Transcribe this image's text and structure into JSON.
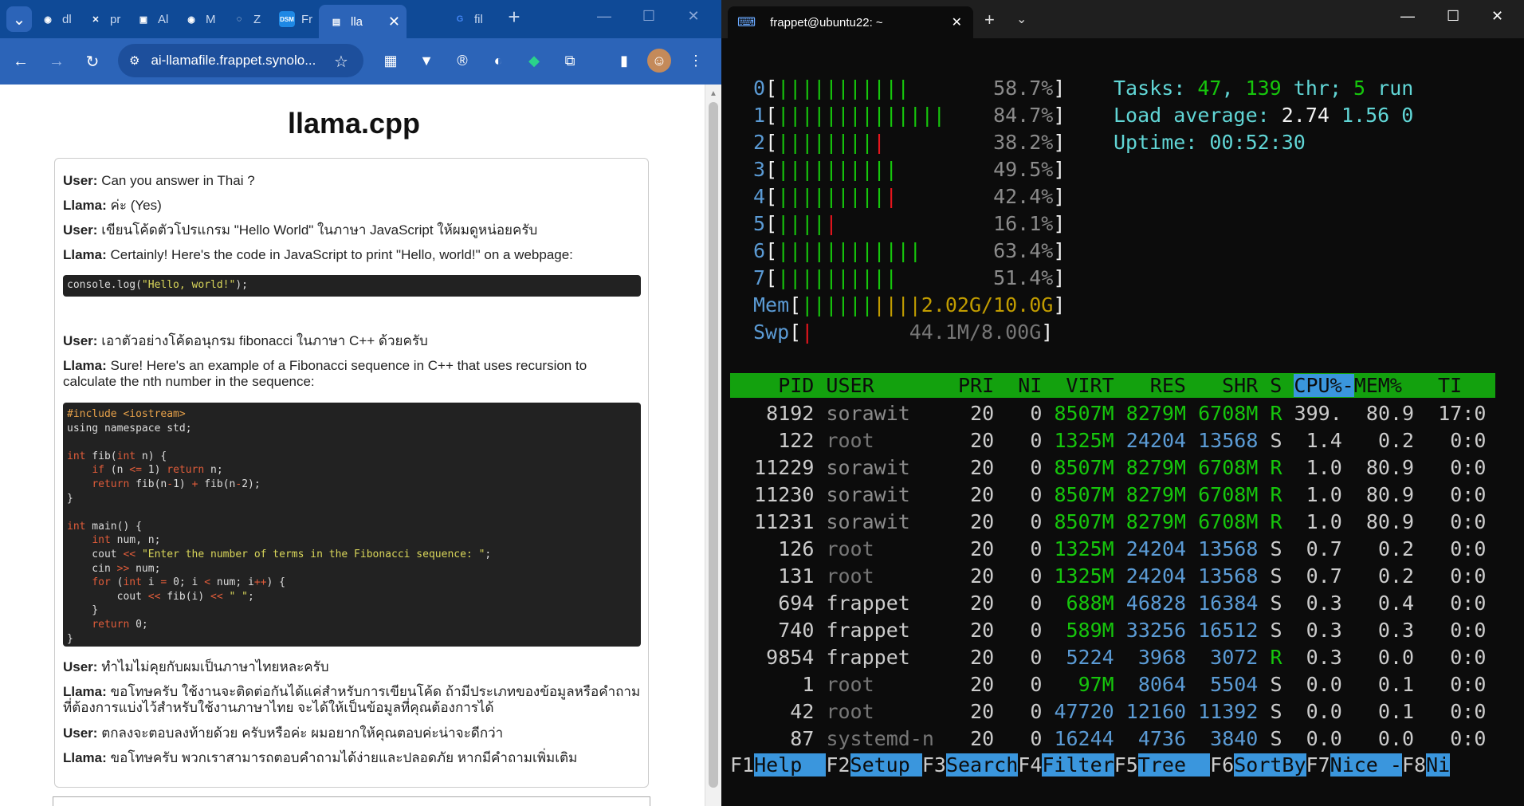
{
  "browser": {
    "tabs": [
      {
        "label": "dl",
        "icon": "github-icon"
      },
      {
        "label": "pr",
        "icon": "x-logo-icon"
      },
      {
        "label": "Al",
        "icon": "shield-icon"
      },
      {
        "label": "M",
        "icon": "github-icon"
      },
      {
        "label": "Z",
        "icon": "zerotier-icon"
      },
      {
        "label": "Fr",
        "icon": "dsm-icon"
      },
      {
        "label": "lla",
        "icon": "page-icon"
      },
      {
        "label": "fil",
        "icon": "google-icon"
      }
    ],
    "address": "ai-llamafile.frappet.synolo...",
    "page_title": "llama.cpp",
    "messages": [
      {
        "who": "User:",
        "text": " Can you answer in Thai ?"
      },
      {
        "who": "Llama:",
        "text": " ค่ะ (Yes)"
      },
      {
        "who": "User:",
        "text": " เขียนโค้ดตัวโปรแกรม \"Hello World\" ในภาษา JavaScript ให้ผมดูหน่อยครับ"
      },
      {
        "who": "Llama:",
        "text": " Certainly! Here's the code in JavaScript to print \"Hello, world!\" on a webpage:"
      },
      {
        "who": "User:",
        "text": " เอาตัวอย่างโค้ดอนุกรม fibonacci ในภาษา C++ ด้วยครับ"
      },
      {
        "who": "Llama:",
        "text": " Sure! Here's an example of a Fibonacci sequence in C++ that uses recursion to calculate the nth number in the sequence:"
      },
      {
        "who": "User:",
        "text": " ทำไมไม่คุยกับผมเป็นภาษาไทยหละครับ"
      },
      {
        "who": "Llama:",
        "text": " ขอโทษครับ ใช้งานจะติดต่อกันได้แค่สำหรับการเขียนโค้ด ถ้ามีประเภทของข้อมูลหรือคำถามที่ต้องการแบ่งไว้สำหรับใช้งานภาษาไทย จะได้ให้เป็นข้อมูลที่คุณต้องการได้"
      },
      {
        "who": "User:",
        "text": " ตกลงจะตอบลงท้ายด้วย ครับหรือค่ะ ผมอยากให้คุณตอบค่ะน่าจะดีกว่า"
      },
      {
        "who": "Llama:",
        "text": " ขอโทษครับ พวกเราสามารถตอบคำถามได้ง่ายและปลอดภัย หากมีคำถามเพิ่มเติม"
      }
    ],
    "code1": [
      "console.log(",
      "\"Hello, world!\"",
      ");"
    ],
    "code2": {
      "l1": "#include <iostream>",
      "l2": "using namespace std;",
      "fib_sig": " fib(",
      "fib_sig2": " n) {",
      "if_line": [
        "    ",
        "if",
        " (n ",
        "<=",
        " 1) ",
        "return",
        " n;"
      ],
      "ret_line": [
        "    ",
        "return",
        " fib(n",
        "-",
        "1) ",
        "+",
        " fib(n",
        "-",
        "2);"
      ],
      "main_sig": " main() {",
      "decl": " num, n;",
      "cout1": [
        "    cout ",
        "<<",
        " ",
        "\"Enter the number of terms in the Fibonacci sequence: \"",
        ";"
      ],
      "cin": [
        "    cin ",
        ">>",
        " num;"
      ],
      "for_line": [
        "    ",
        "for",
        " (",
        "int",
        " i ",
        "=",
        " 0; i ",
        "<",
        " num; i",
        "++",
        ") {"
      ],
      "cout2": [
        "        cout ",
        "<<",
        " fib(i) ",
        "<<",
        " ",
        "\" \"",
        ";"
      ],
      "close_in": "    }",
      "ret0": [
        "    ",
        "return",
        " 0;"
      ],
      "close": "}",
      "kw_int": "int",
      "open_brace": "{"
    }
  },
  "terminal": {
    "tab_title": "frappet@ubuntu22: ~",
    "cpus": [
      {
        "id": "0",
        "green": "|||||||||||",
        "red": "",
        "pct": "58.7%"
      },
      {
        "id": "1",
        "green": "||||||||||||||",
        "red": "",
        "pct": "84.7%"
      },
      {
        "id": "2",
        "green": "||||||||",
        "red": "|",
        "pct": "38.2%"
      },
      {
        "id": "3",
        "green": "||||||||||",
        "red": "",
        "pct": "49.5%"
      },
      {
        "id": "4",
        "green": "|||||||||",
        "red": "|",
        "pct": "42.4%"
      },
      {
        "id": "5",
        "green": "||||",
        "red": "|",
        "pct": "16.1%"
      },
      {
        "id": "6",
        "green": "||||||||||||",
        "red": "",
        "pct": "63.4%"
      },
      {
        "id": "7",
        "green": "||||||||||",
        "red": "",
        "pct": "51.4%"
      }
    ],
    "mem": {
      "label": "Mem",
      "green": "||||||",
      "yellow": "||||",
      "value": "2.02G/10.0G"
    },
    "swp": {
      "label": "Swp",
      "red": "|",
      "value": "44.1M/8.00G"
    },
    "tasks": {
      "label": "Tasks: ",
      "a": "47",
      "b": ", ",
      "c": "139",
      "d": " thr; ",
      "e": "5",
      "f": " run"
    },
    "load": {
      "label": "Load average: ",
      "a": "2.74",
      "b": "1.56",
      "c": "0"
    },
    "uptime": {
      "label": "Uptime: ",
      "value": "00:52:30"
    },
    "header": [
      "    PID USER       PRI  NI  VIRT   RES   SHR S ",
      "CPU%-",
      "MEM%   TI"
    ],
    "processes": [
      {
        "pid": "8192",
        "user": "sorawit",
        "pri": "20",
        "ni": "0",
        "virt": "8507M",
        "res": "8279M",
        "shr": "6708M",
        "s": "R",
        "cpu": "399.",
        "mem": "80.9",
        "time": "17:0"
      },
      {
        "pid": "122",
        "user": "root",
        "pri": "20",
        "ni": "0",
        "virt": "1325M",
        "res": "24204",
        "shr": "13568",
        "s": "S",
        "cpu": "1.4",
        "mem": "0.2",
        "time": "0:0"
      },
      {
        "pid": "11229",
        "user": "sorawit",
        "pri": "20",
        "ni": "0",
        "virt": "8507M",
        "res": "8279M",
        "shr": "6708M",
        "s": "R",
        "cpu": "1.0",
        "mem": "80.9",
        "time": "0:0"
      },
      {
        "pid": "11230",
        "user": "sorawit",
        "pri": "20",
        "ni": "0",
        "virt": "8507M",
        "res": "8279M",
        "shr": "6708M",
        "s": "R",
        "cpu": "1.0",
        "mem": "80.9",
        "time": "0:0"
      },
      {
        "pid": "11231",
        "user": "sorawit",
        "pri": "20",
        "ni": "0",
        "virt": "8507M",
        "res": "8279M",
        "shr": "6708M",
        "s": "R",
        "cpu": "1.0",
        "mem": "80.9",
        "time": "0:0"
      },
      {
        "pid": "126",
        "user": "root",
        "pri": "20",
        "ni": "0",
        "virt": "1325M",
        "res": "24204",
        "shr": "13568",
        "s": "S",
        "cpu": "0.7",
        "mem": "0.2",
        "time": "0:0"
      },
      {
        "pid": "131",
        "user": "root",
        "pri": "20",
        "ni": "0",
        "virt": "1325M",
        "res": "24204",
        "shr": "13568",
        "s": "S",
        "cpu": "0.7",
        "mem": "0.2",
        "time": "0:0"
      },
      {
        "pid": "694",
        "user": "frappet",
        "pri": "20",
        "ni": "0",
        "virt": "688M",
        "res": "46828",
        "shr": "16384",
        "s": "S",
        "cpu": "0.3",
        "mem": "0.4",
        "time": "0:0"
      },
      {
        "pid": "740",
        "user": "frappet",
        "pri": "20",
        "ni": "0",
        "virt": "589M",
        "res": "33256",
        "shr": "16512",
        "s": "S",
        "cpu": "0.3",
        "mem": "0.3",
        "time": "0:0"
      },
      {
        "pid": "9854",
        "user": "frappet",
        "pri": "20",
        "ni": "0",
        "virt": "5224",
        "res": "3968",
        "shr": "3072",
        "s": "R",
        "cpu": "0.3",
        "mem": "0.0",
        "time": "0:0"
      },
      {
        "pid": "1",
        "user": "root",
        "pri": "20",
        "ni": "0",
        "virt": "97M",
        "res": "8064",
        "shr": "5504",
        "s": "S",
        "cpu": "0.0",
        "mem": "0.1",
        "time": "0:0"
      },
      {
        "pid": "42",
        "user": "root",
        "pri": "20",
        "ni": "0",
        "virt": "47720",
        "res": "12160",
        "shr": "11392",
        "s": "S",
        "cpu": "0.0",
        "mem": "0.1",
        "time": "0:0"
      },
      {
        "pid": "87",
        "user": "systemd-n",
        "pri": "20",
        "ni": "0",
        "virt": "16244",
        "res": "4736",
        "shr": "3840",
        "s": "S",
        "cpu": "0.0",
        "mem": "0.0",
        "time": "0:0"
      }
    ],
    "fkeys": [
      {
        "k": "F1",
        "l": "Help  "
      },
      {
        "k": "F2",
        "l": "Setup "
      },
      {
        "k": "F3",
        "l": "Search"
      },
      {
        "k": "F4",
        "l": "Filter"
      },
      {
        "k": "F5",
        "l": "Tree  "
      },
      {
        "k": "F6",
        "l": "SortBy"
      },
      {
        "k": "F7",
        "l": "Nice -"
      },
      {
        "k": "F8",
        "l": "Ni"
      }
    ]
  }
}
